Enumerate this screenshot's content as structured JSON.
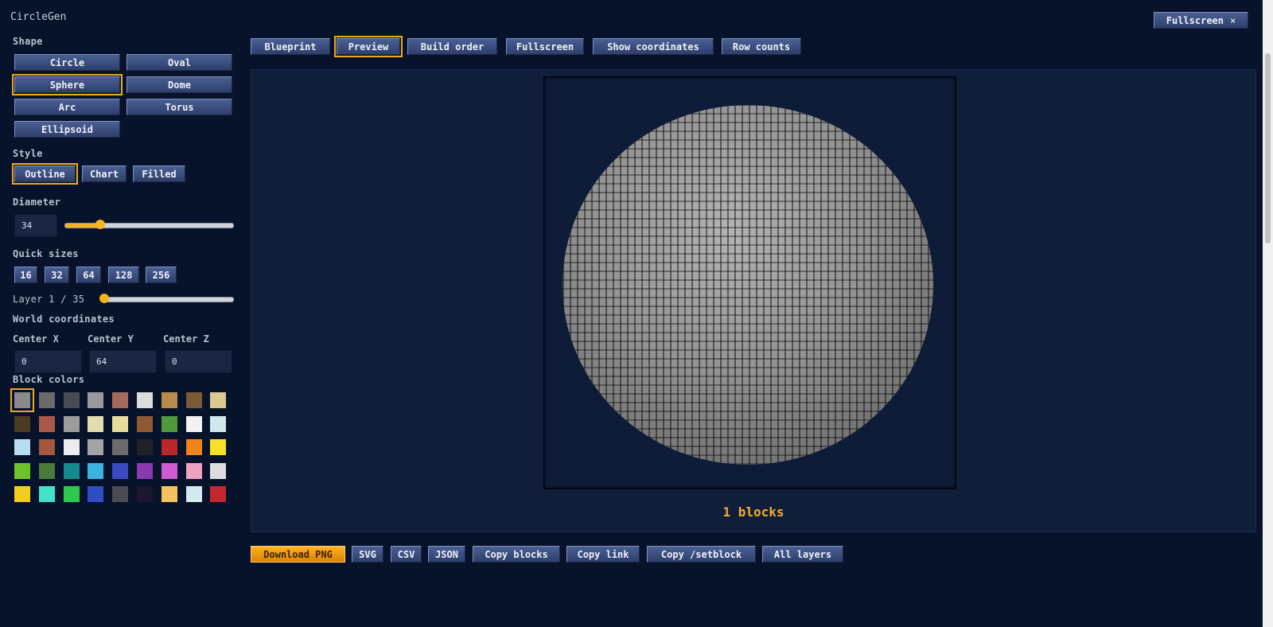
{
  "app": {
    "title": "CircleGen"
  },
  "top_fullscreen": {
    "label": "Fullscreen",
    "close_glyph": "×"
  },
  "sidebar": {
    "shape_label": "Shape",
    "shapes": [
      "Circle",
      "Oval",
      "Sphere",
      "Dome",
      "Arc",
      "Torus",
      "Ellipsoid"
    ],
    "selected_shape": "Sphere",
    "style_label": "Style",
    "styles": [
      "Outline",
      "Chart",
      "Filled"
    ],
    "selected_style": "Outline",
    "diameter_label": "Diameter",
    "diameter_value": "34",
    "diameter_slider_fraction": 0.21,
    "quick_sizes_label": "Quick sizes",
    "quick_sizes": [
      "16",
      "32",
      "64",
      "128",
      "256"
    ],
    "layer_label": "Layer 1 / 35",
    "layer_slider_fraction": 0.0,
    "world_label": "World coordinates",
    "center_x_label": "Center X",
    "center_y_label": "Center Y",
    "center_z_label": "Center Z",
    "center_x": "0",
    "center_y": "64",
    "center_z": "0",
    "colors_label": "Block colors",
    "colors": [
      "#8a8a8a",
      "#6a6a6a",
      "#4a4b52",
      "#9a9a9e",
      "#a9695a",
      "#dcdcdc",
      "#b98a4d",
      "#7c5a35",
      "#dcc891",
      "#4c3a22",
      "#a9584a",
      "#9c9c9c",
      "#e3dcb0",
      "#e8dc9c",
      "#8e5a34",
      "#4e9a3c",
      "#f2f2f2",
      "#cfe8ee",
      "#b8dcf0",
      "#a3583f",
      "#ececec",
      "#a4a4a4",
      "#6c6c6c",
      "#222226",
      "#b8282a",
      "#f0841a",
      "#f6e02a",
      "#6ec22a",
      "#4a7a3a",
      "#148a8e",
      "#3ab2e2",
      "#3a4ac0",
      "#8a3ab0",
      "#d05ad0",
      "#eea2c2",
      "#dcdcdc",
      "#f2cc22",
      "#42e2c8",
      "#2ec84e",
      "#2e4ec2",
      "#4c4a52",
      "#1c1630",
      "#f6c25e",
      "#d2eaf0",
      "#c2282e"
    ],
    "selected_color_index": 0
  },
  "view_tabs": [
    "Blueprint",
    "Preview",
    "Build order",
    "Fullscreen",
    "Show coordinates",
    "Row counts"
  ],
  "selected_view": "Preview",
  "preview": {
    "block_count": "1 blocks",
    "sphere_color": "#8f8f8f"
  },
  "export_buttons": [
    "Download PNG",
    "SVG",
    "CSV",
    "JSON",
    "Copy blocks",
    "Copy link",
    "Copy /setblock",
    "All layers"
  ],
  "accent": "#f0a81c"
}
